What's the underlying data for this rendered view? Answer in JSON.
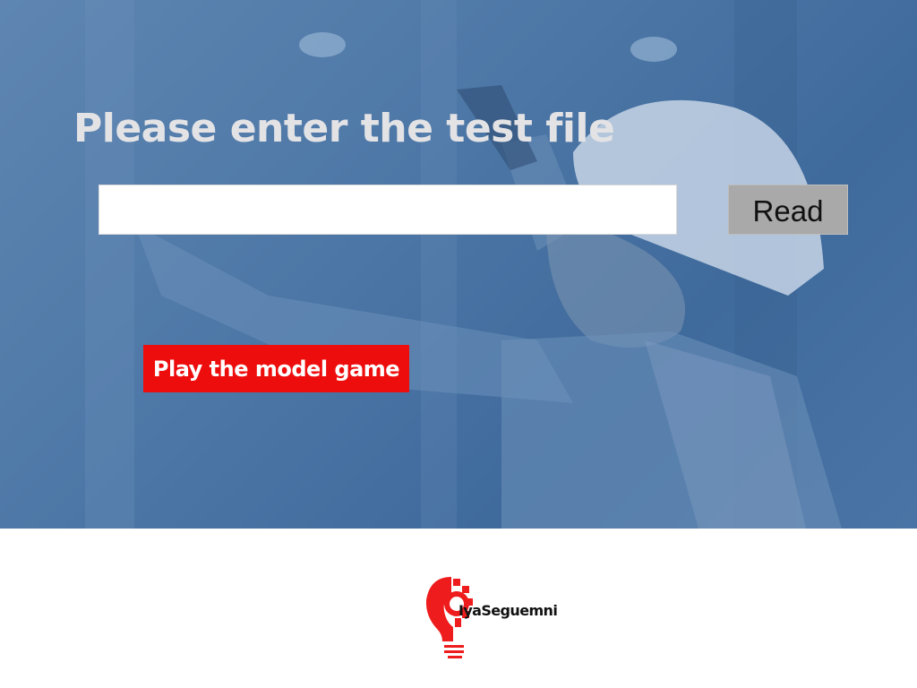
{
  "hero": {
    "title": "Please enter the test file",
    "file_input_value": "",
    "file_input_placeholder": "",
    "read_button_label": "Read",
    "play_button_label": "Play the model game"
  },
  "footer": {
    "logo_text": "IyaSeguemni",
    "logo_icon": "lightbulb-gear-icon"
  },
  "colors": {
    "hero_overlay": "#4d77a6",
    "title_text": "#e3e3e6",
    "read_button": "#a9a9a9",
    "play_button": "#ee0d0d",
    "logo_accent": "#ee1c1c"
  }
}
